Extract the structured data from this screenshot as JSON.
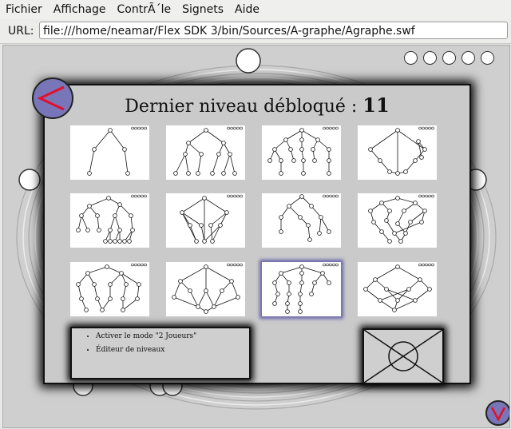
{
  "menu": {
    "items": [
      "Fichier",
      "Affichage",
      "ContrÃ´le",
      "Signets",
      "Aide"
    ]
  },
  "url": {
    "label": "URL:",
    "value": "file:///home/neamar/Flex SDK 3/bin/Sources/A-graphe/Agraphe.swf"
  },
  "game": {
    "title_text": "Dernier niveau débloqué : ",
    "title_number": "11",
    "options": [
      "Activer le mode \"2 Joueurs\"",
      "Éditeur de niveaux"
    ],
    "levels": [
      {
        "index": 1,
        "selected": false
      },
      {
        "index": 2,
        "selected": false
      },
      {
        "index": 3,
        "selected": false
      },
      {
        "index": 4,
        "selected": false
      },
      {
        "index": 5,
        "selected": false
      },
      {
        "index": 6,
        "selected": false
      },
      {
        "index": 7,
        "selected": false
      },
      {
        "index": 8,
        "selected": false
      },
      {
        "index": 9,
        "selected": false
      },
      {
        "index": 10,
        "selected": false
      },
      {
        "index": 11,
        "selected": true
      },
      {
        "index": 12,
        "selected": false
      }
    ],
    "colors": {
      "button": "#7876b8",
      "arrow": "#e0102a",
      "selection": "#6a66a8"
    }
  }
}
